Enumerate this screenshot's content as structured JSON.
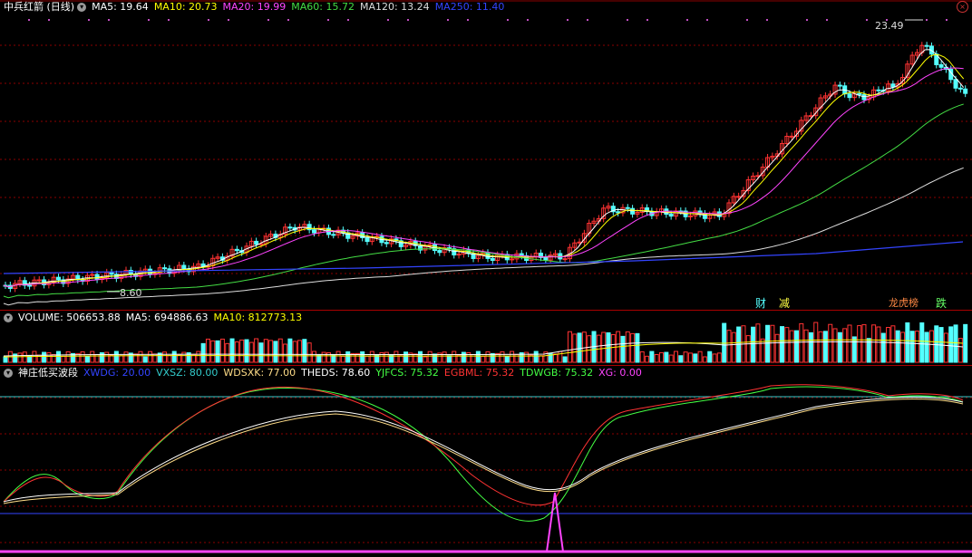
{
  "colors": {
    "up": "#ff3333",
    "down": "#54ffff",
    "ma5": "#ffffff",
    "ma10": "#ffff00",
    "ma20": "#ff44ff",
    "ma60": "#44dd44",
    "ma120": "#dddddd",
    "ma250": "#3344ff",
    "grid": "#8b0000"
  },
  "price_panel": {
    "title": "中兵红箭 (日线)",
    "ma5": "MA5: 19.64",
    "ma10": "MA10: 20.73",
    "ma20": "MA20: 19.99",
    "ma60": "MA60: 15.72",
    "ma120": "MA120: 13.24",
    "ma250": "MA250: 11.40",
    "high_label": "23.49",
    "low_label": "8.60",
    "events": [
      "财",
      "减",
      "龙虎榜",
      "跌"
    ]
  },
  "volume_panel": {
    "volume": "VOLUME: 506653.88",
    "ma5": "MA5: 694886.63",
    "ma10": "MA10: 812773.13"
  },
  "indicator_panel": {
    "name": "神庄低买波段",
    "values": [
      "XWDG: 20.00",
      "VXSZ: 80.00",
      "WDSXK: 77.00",
      "THEDS: 78.60",
      "YJFCS: 75.32",
      "EGBML: 75.32",
      "TDWGB: 75.32",
      "XG: 0.00"
    ],
    "value_colors": [
      "#3344ff",
      "#33cccc",
      "#ffdd88",
      "#ffffff",
      "#44ff44",
      "#ff3333",
      "#44ff44",
      "#ff44ff"
    ]
  }
}
